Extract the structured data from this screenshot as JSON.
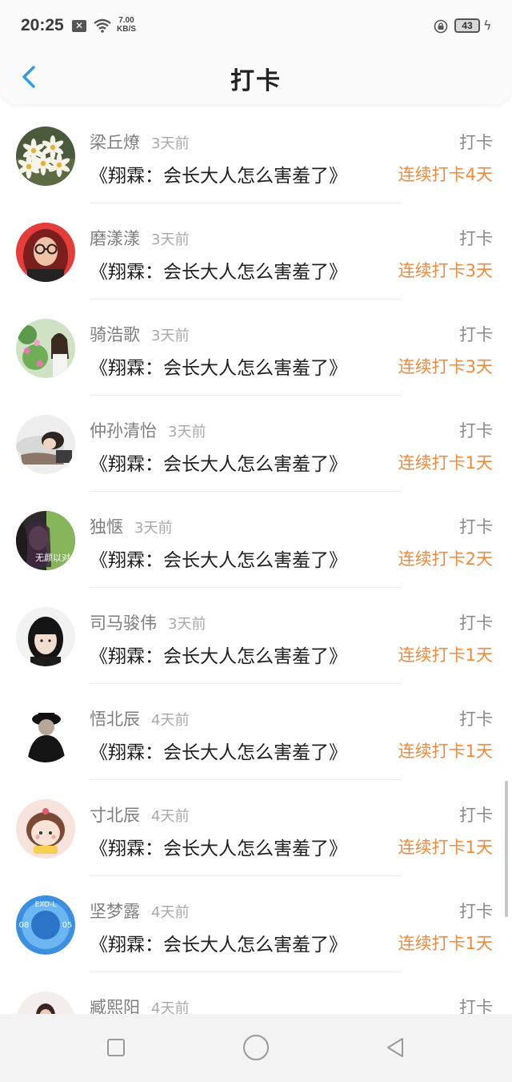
{
  "status_bar": {
    "time": "20:25",
    "network_speed_value": "7.00",
    "network_speed_unit": "KB/S",
    "battery": "43"
  },
  "header": {
    "title": "打卡",
    "back_icon": "chevron-left-icon",
    "accent_color": "#2e9bf0"
  },
  "colors": {
    "streak": "#f08a3c",
    "name": "#7e7e7e",
    "time": "#a9a9a9"
  },
  "checkins": [
    {
      "name": "梁丘燎",
      "time": "3天前",
      "action": "打卡",
      "work": "《翔霖：会长大人怎么害羞了》",
      "streak": "连续打卡4天"
    },
    {
      "name": "磨漾漾",
      "time": "3天前",
      "action": "打卡",
      "work": "《翔霖：会长大人怎么害羞了》",
      "streak": "连续打卡3天"
    },
    {
      "name": "骑浩歌",
      "time": "3天前",
      "action": "打卡",
      "work": "《翔霖：会长大人怎么害羞了》",
      "streak": "连续打卡3天"
    },
    {
      "name": "仲孙清怡",
      "time": "3天前",
      "action": "打卡",
      "work": "《翔霖：会长大人怎么害羞了》",
      "streak": "连续打卡1天"
    },
    {
      "name": "独惬",
      "time": "3天前",
      "action": "打卡",
      "work": "《翔霖：会长大人怎么害羞了》",
      "streak": "连续打卡2天"
    },
    {
      "name": "司马骏伟",
      "time": "3天前",
      "action": "打卡",
      "work": "《翔霖：会长大人怎么害羞了》",
      "streak": "连续打卡1天"
    },
    {
      "name": "悟北辰",
      "time": "4天前",
      "action": "打卡",
      "work": "《翔霖：会长大人怎么害羞了》",
      "streak": "连续打卡1天"
    },
    {
      "name": "寸北辰",
      "time": "4天前",
      "action": "打卡",
      "work": "《翔霖：会长大人怎么害羞了》",
      "streak": "连续打卡1天"
    },
    {
      "name": "坚梦露",
      "time": "4天前",
      "action": "打卡",
      "work": "《翔霖：会长大人怎么害羞了》",
      "streak": "连续打卡1天"
    },
    {
      "name": "臧熙阳",
      "time": "4天前",
      "action": "打卡",
      "work": "",
      "streak": ""
    }
  ],
  "avatar_texts": {
    "dugie": "无颜以对",
    "exo_top": "EXO-L",
    "exo_left": "08",
    "exo_right": "05"
  },
  "nav_bar": {
    "icons": [
      "square-icon",
      "home-circle-icon",
      "back-triangle-icon"
    ]
  }
}
